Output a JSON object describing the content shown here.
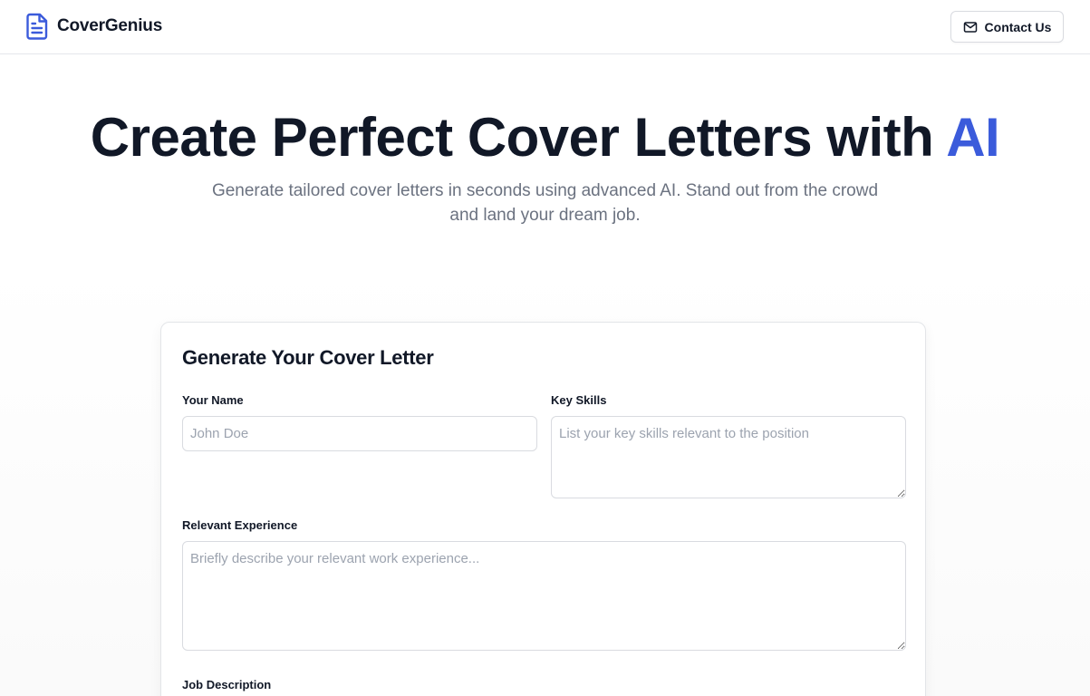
{
  "header": {
    "brand": "CoverGenius",
    "logo_icon": "document-icon",
    "contact_label": "Contact Us",
    "contact_icon": "mail-icon"
  },
  "hero": {
    "title_main": "Create Perfect Cover Letters with ",
    "title_accent": "AI",
    "subtitle": "Generate tailored cover letters in seconds using advanced AI. Stand out from the crowd and land your dream job."
  },
  "form": {
    "title": "Generate Your Cover Letter",
    "name": {
      "label": "Your Name",
      "placeholder": "John Doe",
      "value": ""
    },
    "skills": {
      "label": "Key Skills",
      "placeholder": "List your key skills relevant to the position",
      "value": ""
    },
    "experience": {
      "label": "Relevant Experience",
      "placeholder": "Briefly describe your relevant work experience...",
      "value": ""
    },
    "job_description": {
      "label": "Job Description"
    }
  },
  "colors": {
    "accent": "#3b5bdb",
    "text": "#111827",
    "muted": "#6b7280",
    "border": "#d9dbe0"
  }
}
